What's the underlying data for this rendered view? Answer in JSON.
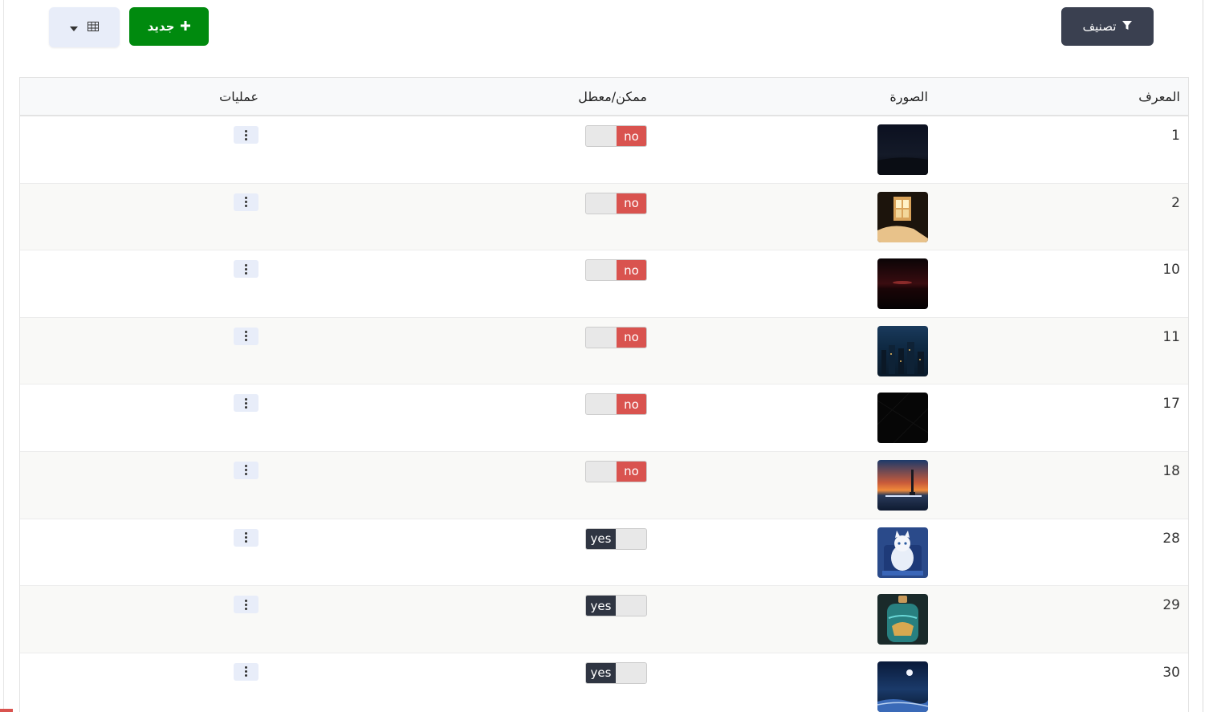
{
  "toolbar": {
    "filter_label": "تصنيف",
    "new_label": "جديد",
    "view_icon": "table-icon"
  },
  "table": {
    "headers": {
      "id": "المعرف",
      "image": "الصورة",
      "status": "ممكن/معطل",
      "ops": "عمليات"
    },
    "rows": [
      {
        "id": "1",
        "status": "no",
        "enabled": false
      },
      {
        "id": "2",
        "status": "no",
        "enabled": false
      },
      {
        "id": "10",
        "status": "no",
        "enabled": false
      },
      {
        "id": "11",
        "status": "no",
        "enabled": false
      },
      {
        "id": "17",
        "status": "no",
        "enabled": false
      },
      {
        "id": "18",
        "status": "no",
        "enabled": false
      },
      {
        "id": "28",
        "status": "yes",
        "enabled": true
      },
      {
        "id": "29",
        "status": "yes",
        "enabled": true
      },
      {
        "id": "30",
        "status": "yes",
        "enabled": true
      }
    ]
  },
  "colors": {
    "filter_bg": "#3a4050",
    "new_bg": "#008a0e",
    "toggle_no": "#d9534f",
    "toggle_yes": "#2f3542"
  }
}
